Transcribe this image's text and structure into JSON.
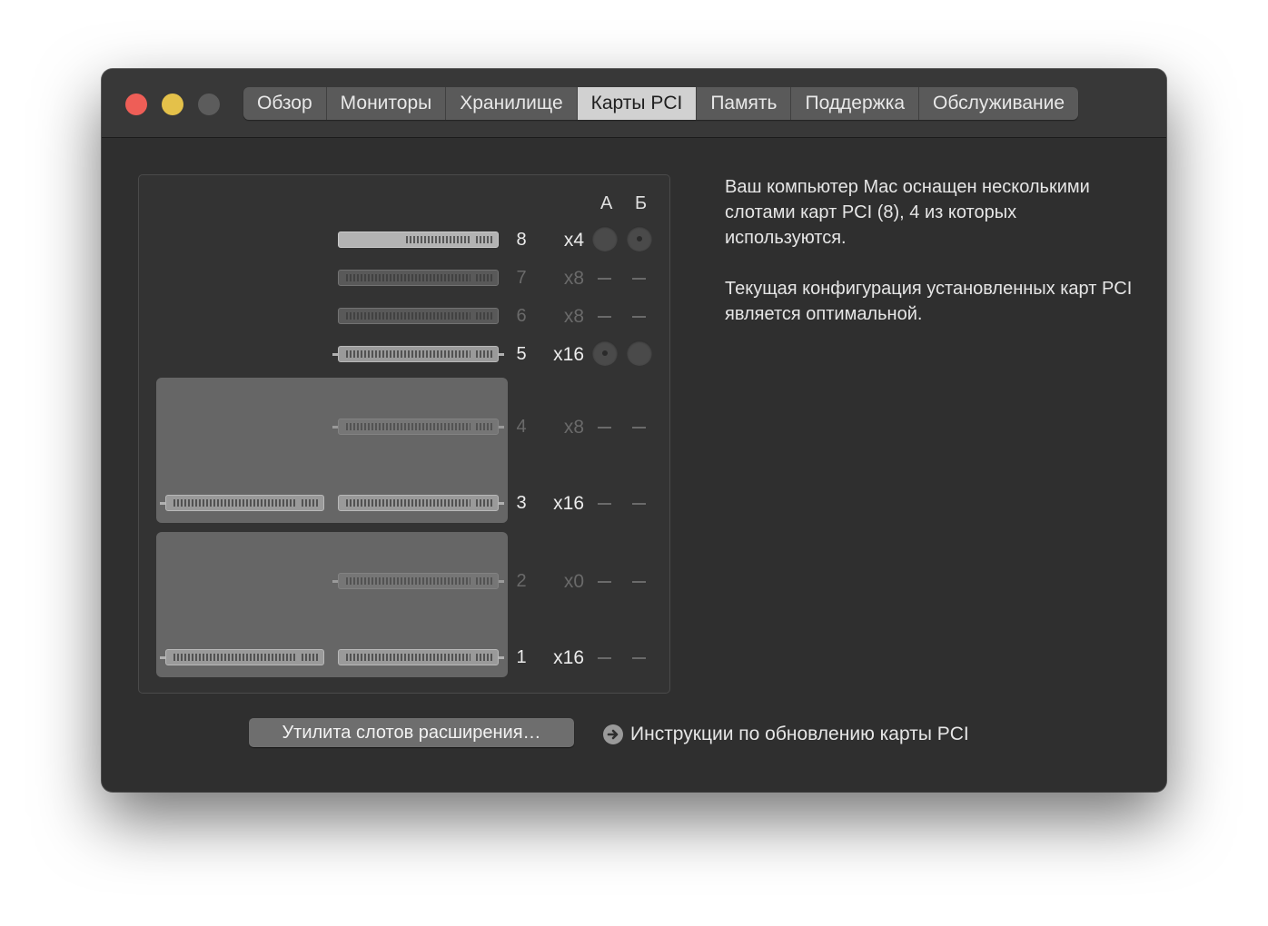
{
  "window": {
    "tabs": [
      {
        "label": "Обзор",
        "active": false
      },
      {
        "label": "Мониторы",
        "active": false
      },
      {
        "label": "Хранилище",
        "active": false
      },
      {
        "label": "Карты PCI",
        "active": true
      },
      {
        "label": "Память",
        "active": false
      },
      {
        "label": "Поддержка",
        "active": false
      },
      {
        "label": "Обслуживание",
        "active": false
      }
    ]
  },
  "slots": {
    "columns": {
      "a": "А",
      "b": "Б"
    },
    "rows": [
      {
        "num": "8",
        "lanes": "x4",
        "enabled": true,
        "a": "indicator",
        "b": "indicator-dot"
      },
      {
        "num": "7",
        "lanes": "x8",
        "enabled": false,
        "a": "dash",
        "b": "dash"
      },
      {
        "num": "6",
        "lanes": "x8",
        "enabled": false,
        "a": "dash",
        "b": "dash"
      },
      {
        "num": "5",
        "lanes": "x16",
        "enabled": true,
        "a": "indicator-dot",
        "b": "indicator"
      },
      {
        "num": "4",
        "lanes": "x8",
        "enabled": false,
        "a": "dash",
        "b": "dash"
      },
      {
        "num": "3",
        "lanes": "x16",
        "enabled": true,
        "a": "dash",
        "b": "dash"
      },
      {
        "num": "2",
        "lanes": "x0",
        "enabled": false,
        "a": "dash",
        "b": "dash"
      },
      {
        "num": "1",
        "lanes": "x16",
        "enabled": true,
        "a": "dash",
        "b": "dash"
      }
    ]
  },
  "info": {
    "para1": "Ваш компьютер Mac оснащен несколькими слотами карт PCI (8), 4 из которых используются.",
    "para2": "Текущая конфигурация установленных карт PCI является оптимальной."
  },
  "footer": {
    "utility_button": "Утилита слотов расширения…",
    "help_link": "Инструкции по обновлению карты PCI"
  }
}
